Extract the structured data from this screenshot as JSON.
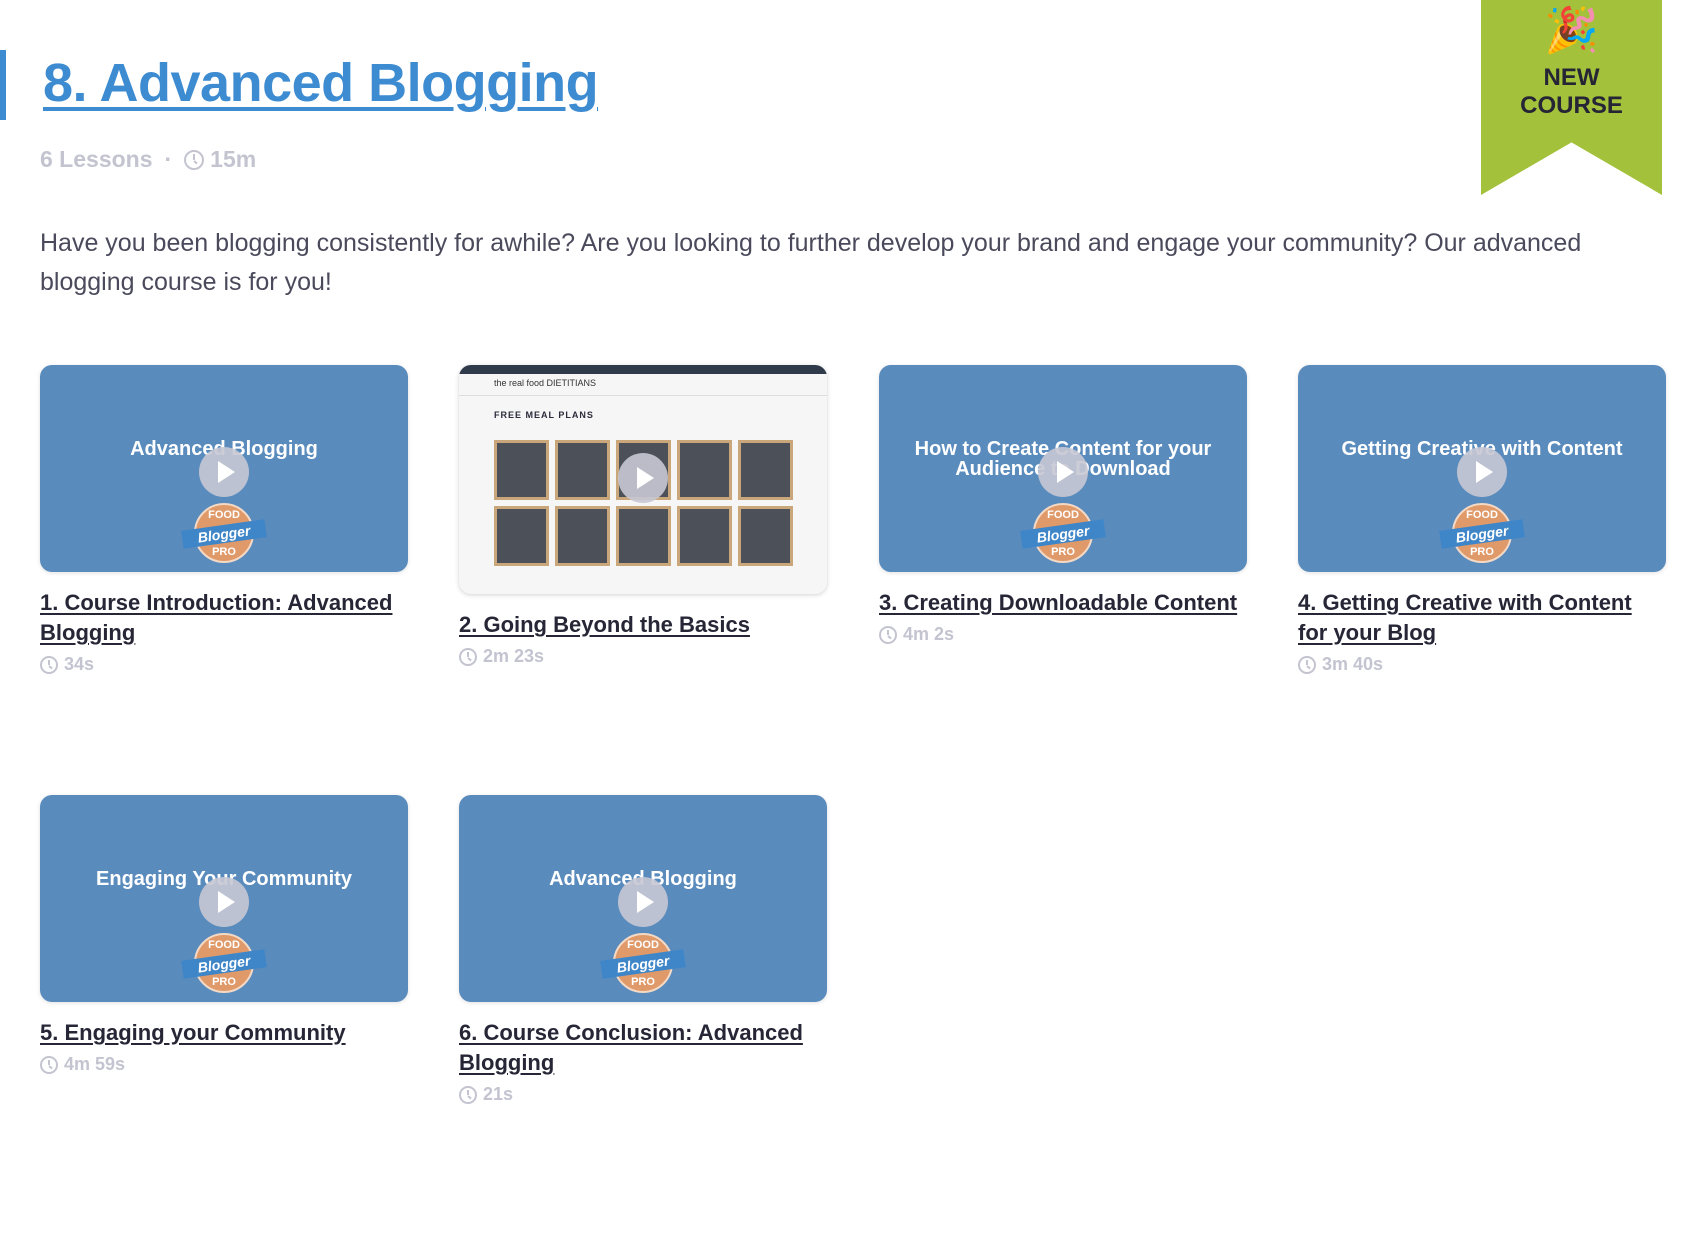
{
  "course": {
    "title": "8. Advanced Blogging",
    "lessons_count": "6 Lessons",
    "separator": "·",
    "duration": "15m",
    "description": "Have you been blogging consistently for awhile? Are you looking to further develop your brand and engage your community? Our advanced blogging course is for you!",
    "accent_color": "#3d8bd0"
  },
  "badge": {
    "emoji": "🎉",
    "line1": "NEW",
    "line2": "COURSE",
    "color": "#a3c13a"
  },
  "logo": {
    "line1": "FOOD",
    "line2": "Blogger",
    "line3": "PRO"
  },
  "lessons": [
    {
      "title": "1. Course Introduction: Advanced Blogging",
      "thumb_text": "Advanced Blogging",
      "duration": "34s"
    },
    {
      "title": "2. Going Beyond the Basics",
      "thumb_text": "",
      "duration": "2m 23s",
      "screenshot": {
        "site": "the real food DIETITIANS",
        "heading": "FREE MEAL PLANS"
      }
    },
    {
      "title": "3. Creating Downloadable Content",
      "thumb_text": "How to Create Content for your Audience to Download",
      "duration": "4m 2s"
    },
    {
      "title": "4. Getting Creative with Content for your Blog",
      "thumb_text": "Getting Creative with Content",
      "duration": "3m 40s"
    },
    {
      "title": "5. Engaging your Community",
      "thumb_text": "Engaging Your Community",
      "duration": "4m 59s"
    },
    {
      "title": "6. Course Conclusion: Advanced Blogging",
      "thumb_text": "Advanced Blogging",
      "duration": "21s"
    }
  ]
}
